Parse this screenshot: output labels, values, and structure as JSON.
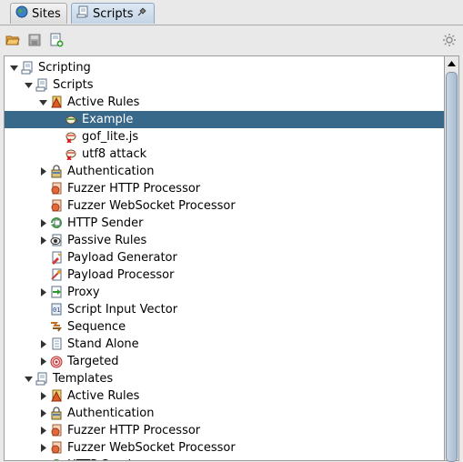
{
  "tabs": [
    {
      "label": "Sites",
      "icon": "globe-icon"
    },
    {
      "label": "Scripts",
      "icon": "scroll-icon",
      "pin_icon": "pin-icon"
    }
  ],
  "toolbar": {
    "open_icon": "folder-open-icon",
    "save_icon": "floppy-icon",
    "new_icon": "new-script-icon",
    "options_icon": "gear-icon"
  },
  "tree": {
    "nodes": [
      {
        "label": "Scripting",
        "icon": "scroll-icon",
        "toggle": "expanded"
      },
      {
        "label": "Scripts",
        "icon": "scroll-icon",
        "toggle": "expanded"
      },
      {
        "label": "Active Rules",
        "icon": "active-rules-icon",
        "toggle": "expanded"
      },
      {
        "label": "Example",
        "icon": "script-enabled-icon",
        "toggle": "none",
        "selected": true
      },
      {
        "label": "gof_lite.js",
        "icon": "script-disabled-icon",
        "toggle": "none"
      },
      {
        "label": "utf8 attack",
        "icon": "script-disabled-icon",
        "toggle": "none"
      },
      {
        "label": "Authentication",
        "icon": "authentication-icon",
        "toggle": "collapsed"
      },
      {
        "label": "Fuzzer HTTP Processor",
        "icon": "fuzzer-icon",
        "toggle": "none"
      },
      {
        "label": "Fuzzer WebSocket Processor",
        "icon": "fuzzer-icon",
        "toggle": "none"
      },
      {
        "label": "HTTP Sender",
        "icon": "http-sender-icon",
        "toggle": "collapsed"
      },
      {
        "label": "Passive Rules",
        "icon": "passive-rules-icon",
        "toggle": "collapsed"
      },
      {
        "label": "Payload Generator",
        "icon": "payload-generator-icon",
        "toggle": "none"
      },
      {
        "label": "Payload Processor",
        "icon": "payload-processor-icon",
        "toggle": "none"
      },
      {
        "label": "Proxy",
        "icon": "proxy-icon",
        "toggle": "collapsed"
      },
      {
        "label": "Script Input Vector",
        "icon": "input-vector-icon",
        "toggle": "none"
      },
      {
        "label": "Sequence",
        "icon": "sequence-icon",
        "toggle": "none"
      },
      {
        "label": "Stand Alone",
        "icon": "stand-alone-icon",
        "toggle": "collapsed"
      },
      {
        "label": "Targeted",
        "icon": "targeted-icon",
        "toggle": "collapsed"
      },
      {
        "label": "Templates",
        "icon": "scroll-icon",
        "toggle": "expanded"
      },
      {
        "label": "Active Rules",
        "icon": "active-rules-icon",
        "toggle": "collapsed"
      },
      {
        "label": "Authentication",
        "icon": "authentication-icon",
        "toggle": "collapsed"
      },
      {
        "label": "Fuzzer HTTP Processor",
        "icon": "fuzzer-icon",
        "toggle": "collapsed"
      },
      {
        "label": "Fuzzer WebSocket Processor",
        "icon": "fuzzer-icon",
        "toggle": "collapsed"
      },
      {
        "label": "HTTP Sender",
        "icon": "http-sender-icon",
        "toggle": "collapsed"
      }
    ]
  },
  "colors": {
    "selection": "#39698a",
    "panel": "#e9e9e9"
  }
}
